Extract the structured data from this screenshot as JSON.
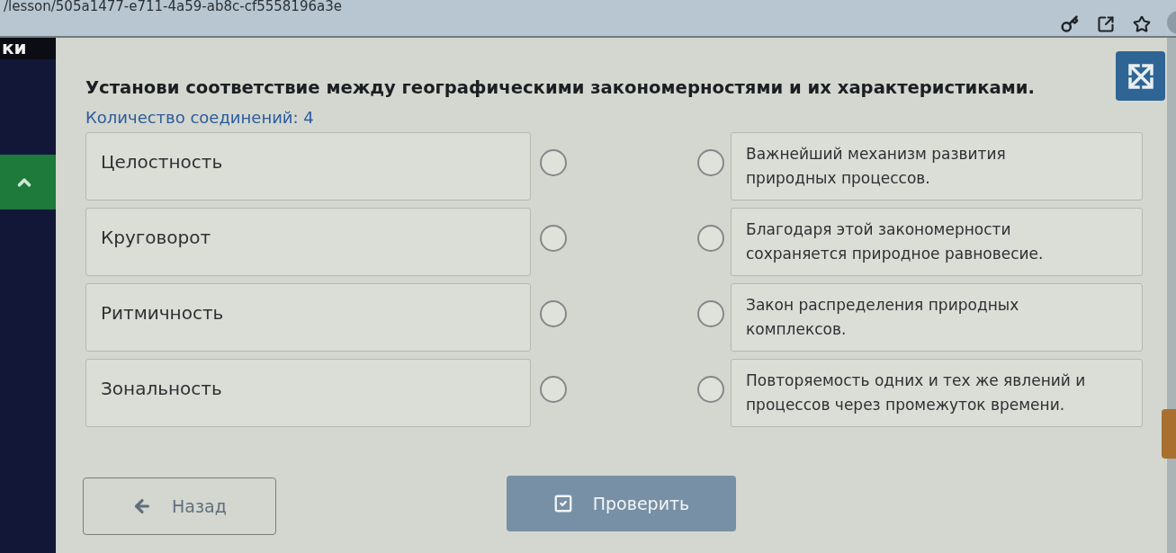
{
  "browser": {
    "address": "/lesson/505a1477-e711-4a59-ab8c-cf5558196a3e"
  },
  "sidebar": {
    "label": "ки"
  },
  "task": {
    "title": "Установи соответствие между географическими закономерностями и их характеристиками.",
    "connections_count": "Количество соединений: 4"
  },
  "left_items": [
    {
      "text": "Целостность"
    },
    {
      "text": "Круговорот"
    },
    {
      "text": "Ритмичность"
    },
    {
      "text": "Зональность"
    }
  ],
  "right_items": [
    {
      "text": "Важнейший механизм развития природных процессов."
    },
    {
      "text": "Благодаря этой закономерности сохраняется природное равновесие."
    },
    {
      "text": "Закон распределения природных комплексов."
    },
    {
      "text": "Повторяемость одних и тех же явлений и процессов через промежуток времени."
    }
  ],
  "buttons": [
    {
      "kind": "back",
      "label": "Назад",
      "disabled": false
    },
    {
      "kind": "check",
      "label": "Проверить",
      "disabled": true
    }
  ]
}
